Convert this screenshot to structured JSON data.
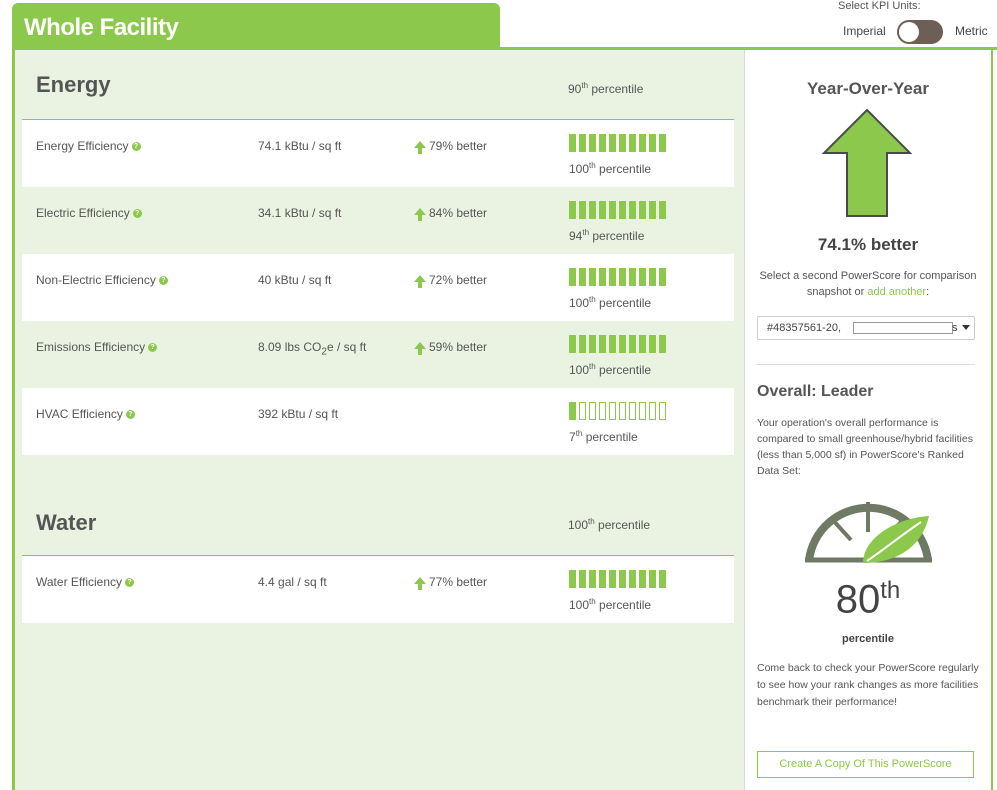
{
  "header": {
    "title": "Whole Facility"
  },
  "kpi_units": {
    "label": "Select KPI Units:",
    "imperial": "Imperial",
    "metric": "Metric",
    "selected": "Metric"
  },
  "colors": {
    "accent": "#8cc84b",
    "panel_bg": "#eaf3e1",
    "toggle": "#6d5f55"
  },
  "energy": {
    "title": "Energy",
    "percentile_num": "90",
    "percentile_sup": "th",
    "percentile_word": " percentile",
    "rows": [
      {
        "name": "Energy Efficiency",
        "value": "74.1 kBtu / sq ft",
        "better": "79% better",
        "bars_filled": 10,
        "pct_num": "100",
        "pct_sup": "th",
        "pct_word": " percentile"
      },
      {
        "name": "Electric Efficiency",
        "value": "34.1 kBtu / sq ft",
        "better": "84% better",
        "bars_filled": 10,
        "pct_num": "94",
        "pct_sup": "th",
        "pct_word": " percentile"
      },
      {
        "name": "Non-Electric Efficiency",
        "value": "40 kBtu / sq ft",
        "better": "72% better",
        "bars_filled": 10,
        "pct_num": "100",
        "pct_sup": "th",
        "pct_word": " percentile"
      },
      {
        "name": "Emissions Efficiency",
        "value_pre": "8.09 lbs CO",
        "value_sub": "2",
        "value_post": "e / sq ft",
        "better": "59% better",
        "bars_filled": 10,
        "pct_num": "100",
        "pct_sup": "th",
        "pct_word": " percentile"
      },
      {
        "name": "HVAC Efficiency",
        "value": "392 kBtu / sq ft",
        "better": "",
        "bars_filled": 1,
        "pct_num": "7",
        "pct_sup": "th",
        "pct_word": " percentile"
      }
    ]
  },
  "water": {
    "title": "Water",
    "percentile_num": "100",
    "percentile_sup": "th",
    "percentile_word": " percentile",
    "rows": [
      {
        "name": "Water Efficiency",
        "value": "4.4 gal / sq ft",
        "better": "77% better",
        "bars_filled": 10,
        "pct_num": "100",
        "pct_sup": "th",
        "pct_word": " percentile"
      }
    ]
  },
  "sidebar": {
    "yoy_title": "Year-Over-Year",
    "yoy_value": "74.1% better",
    "select_text": "Select a second PowerScore for comparison snapshot or ",
    "add_link": "add another",
    "colon": ":",
    "dropdown_value": "#48357561-20,",
    "dropdown_tail": "s",
    "overall_title": "Overall: Leader",
    "overall_desc": "Your operation's overall performance is compared to small greenhouse/hybrid facilities (less than 5,000 sf) in PowerScore's Ranked Data Set:",
    "rank_num": "80",
    "rank_sup": "th",
    "rank_word": "percentile",
    "come_back": "Come back to check your PowerScore regularly to see how your rank changes as more facilities benchmark their performance!",
    "copy_button": "Create A Copy Of This PowerScore"
  }
}
